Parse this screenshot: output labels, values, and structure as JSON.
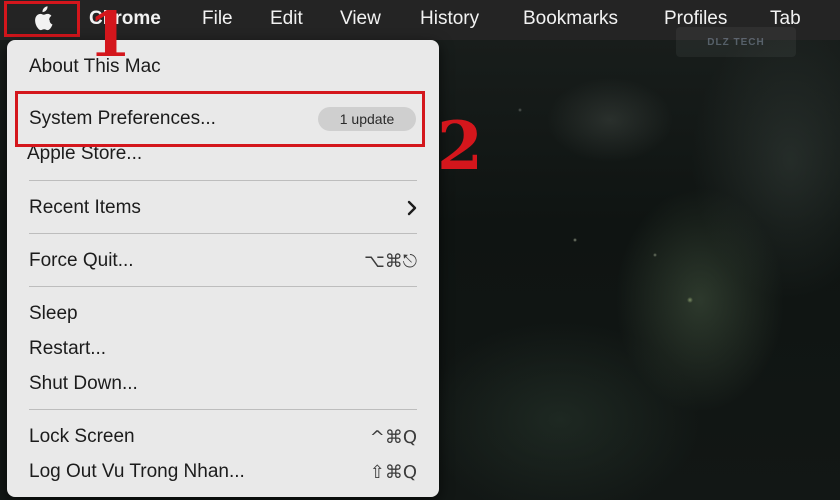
{
  "menubar": {
    "apple_icon": "apple-logo-icon",
    "app_name": "Chrome",
    "items": [
      "File",
      "Edit",
      "View",
      "History",
      "Bookmarks",
      "Profiles",
      "Tab"
    ]
  },
  "watermark": "DLZ TECH",
  "apple_menu": {
    "about": "About This Mac",
    "system_prefs": "System Preferences...",
    "update_badge": "1 update",
    "app_store": "Apple Store...",
    "recent_items": "Recent Items",
    "force_quit": "Force Quit...",
    "force_quit_shortcut": "⌥⌘⎋",
    "sleep": "Sleep",
    "restart": "Restart...",
    "shut_down": "Shut Down...",
    "lock_screen": "Lock Screen",
    "lock_screen_shortcut": "^⌘Q",
    "log_out": "Log Out Vu Trong Nhan...",
    "log_out_shortcut": "⇧⌘Q"
  },
  "annotations": {
    "step1": "1",
    "step2": "2"
  },
  "colors": {
    "annotation_red": "#d4161c",
    "menu_bg": "#e9e9e9",
    "menubar_bg": "#242424"
  }
}
